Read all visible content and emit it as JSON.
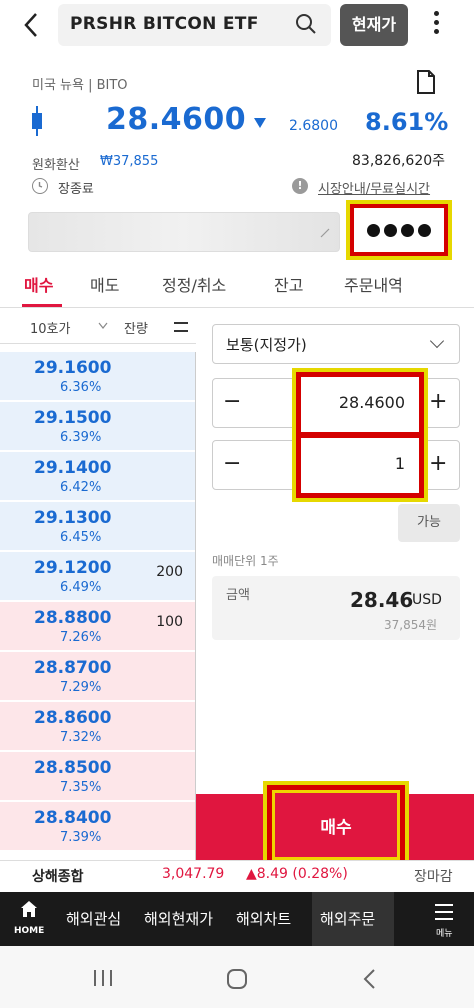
{
  "header": {
    "stock_name": "PRSHR BITCON ETF",
    "current_price_button": "현재가"
  },
  "quote": {
    "market": "미국 뉴욕 | BITO",
    "price": "28.4600",
    "change": "2.6800",
    "change_pct": "8.61%",
    "fx_label": "원화환산",
    "fx_value": "₩37,855",
    "volume": "83,826,620주",
    "status": "장종료",
    "info_link": "시장안내/무료실시간"
  },
  "tabs": [
    "매수",
    "매도",
    "정정/취소",
    "잔고",
    "주문내역"
  ],
  "orderbook": {
    "header_levels": "10호가",
    "header_qty": "잔량",
    "asks": [
      {
        "price": "29.1600",
        "rate": "6.36%",
        "qty": ""
      },
      {
        "price": "29.1500",
        "rate": "6.39%",
        "qty": ""
      },
      {
        "price": "29.1400",
        "rate": "6.42%",
        "qty": ""
      },
      {
        "price": "29.1300",
        "rate": "6.45%",
        "qty": ""
      },
      {
        "price": "29.1200",
        "rate": "6.49%",
        "qty": "200"
      }
    ],
    "bids": [
      {
        "price": "28.8800",
        "rate": "7.26%",
        "qty": "100"
      },
      {
        "price": "28.8700",
        "rate": "7.29%",
        "qty": ""
      },
      {
        "price": "28.8600",
        "rate": "7.32%",
        "qty": ""
      },
      {
        "price": "28.8500",
        "rate": "7.35%",
        "qty": ""
      },
      {
        "price": "28.8400",
        "rate": "7.39%",
        "qty": ""
      }
    ]
  },
  "order": {
    "type": "보통(지정가)",
    "price": "28.4600",
    "quantity": "1",
    "available_label": "가능",
    "unit_label": "매매단위 1주",
    "amount_label": "금액",
    "amount_value": "28.46",
    "amount_currency": "USD",
    "amount_krw": "37,854원",
    "buy_button": "매수"
  },
  "ticker": {
    "name": "상해종합",
    "value": "3,047.79",
    "change": "▲8.49 (0.28%)",
    "status": "장마감"
  },
  "bottom_nav": {
    "home": "HOME",
    "items": [
      "해외관심",
      "해외현재가",
      "해외차트",
      "해외주문"
    ],
    "menu": "메뉴"
  },
  "colors": {
    "up": "#e0163f",
    "down": "#1a6ad1",
    "highlight": "#e6d800"
  }
}
